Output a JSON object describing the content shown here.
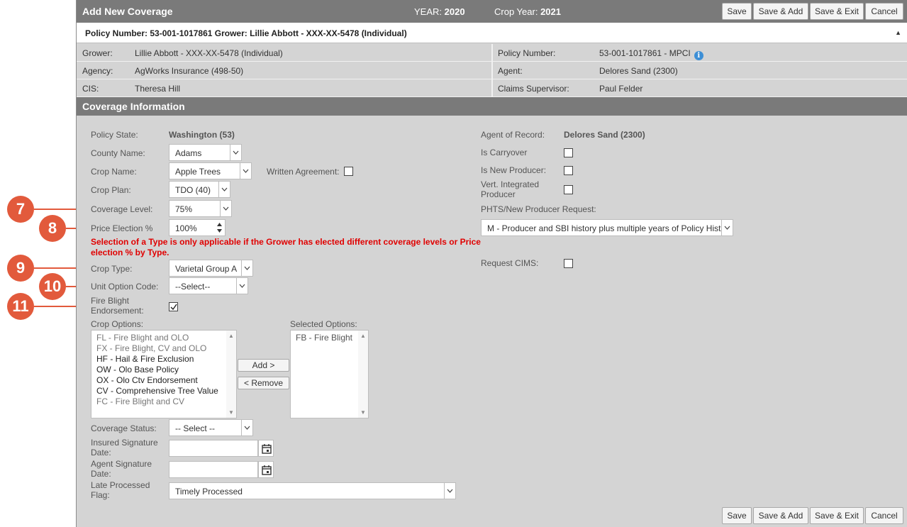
{
  "header": {
    "title": "Add New Coverage",
    "year_label": "YEAR:",
    "year_value": "2020",
    "crop_year_label": "Crop Year:",
    "crop_year_value": "2021",
    "buttons": {
      "save": "Save",
      "save_add": "Save & Add",
      "save_exit": "Save & Exit",
      "cancel": "Cancel"
    }
  },
  "policy_bar": {
    "text": "Policy Number: 53-001-1017861 Grower: Lillie Abbott - XXX-XX-5478 (Individual)",
    "collapse_glyph": "▲"
  },
  "info": {
    "grower_label": "Grower:",
    "grower_value": "Lillie Abbott - XXX-XX-5478 (Individual)",
    "policy_label": "Policy Number:",
    "policy_value": "53-001-1017861 - MPCI",
    "agency_label": "Agency:",
    "agency_value": "AgWorks Insurance (498-50)",
    "agent_label": "Agent:",
    "agent_value": "Delores Sand (2300)",
    "cis_label": "CIS:",
    "cis_value": "Theresa Hill",
    "claims_label": "Claims Supervisor:",
    "claims_value": "Paul Felder",
    "info_icon": "info-icon"
  },
  "section_title": "Coverage Information",
  "form": {
    "policy_state_label": "Policy State:",
    "policy_state_value": "Washington (53)",
    "county_label": "County Name:",
    "county_value": "Adams",
    "crop_name_label": "Crop Name:",
    "crop_name_value": "Apple Trees",
    "written_agreement_label": "Written Agreement:",
    "crop_plan_label": "Crop Plan:",
    "crop_plan_value": "TDO (40)",
    "coverage_level_label": "Coverage Level:",
    "coverage_level_value": "75%",
    "price_election_label": "Price Election %",
    "price_election_value": "100%",
    "warning": "Selection of a Type is only applicable if the Grower has elected different coverage levels or Price election % by Type.",
    "crop_type_label": "Crop Type:",
    "crop_type_value": "Varietal Group A",
    "unit_option_label": "Unit Option Code:",
    "unit_option_value": "--Select--",
    "fire_blight_label": "Fire Blight Endorsement:",
    "fire_blight_checked": true,
    "crop_options_label": "Crop Options:",
    "crop_options": [
      {
        "text": "FL - Fire Blight and OLO",
        "enabled": false
      },
      {
        "text": "FX - Fire Blight, CV and OLO",
        "enabled": false
      },
      {
        "text": "HF - Hail & Fire Exclusion",
        "enabled": true
      },
      {
        "text": "OW - Olo Base Policy",
        "enabled": true
      },
      {
        "text": "OX - Olo Ctv Endorsement",
        "enabled": true
      },
      {
        "text": "CV - Comprehensive Tree Value",
        "enabled": true
      },
      {
        "text": "FC - Fire Blight and CV",
        "enabled": false
      }
    ],
    "add_button": "Add >",
    "remove_button": "< Remove",
    "selected_options_label": "Selected Options:",
    "selected_options": [
      "FB - Fire Blight"
    ],
    "coverage_status_label": "Coverage Status:",
    "coverage_status_value": "-- Select --",
    "insured_sig_label": "Insured Signature Date:",
    "agent_sig_label": "Agent Signature Date:",
    "late_flag_label": "Late Processed Flag:",
    "late_flag_value": "Timely Processed",
    "agent_of_record_label": "Agent of Record:",
    "agent_of_record_value": "Delores Sand (2300)",
    "carryover_label": "Is Carryover",
    "new_producer_label": "Is New Producer:",
    "vert_integrated_label": "Vert. Integrated Producer",
    "phts_label": "PHTS/New Producer Request:",
    "phts_value": "M - Producer and SBI history plus multiple years of Policy History",
    "request_cims_label": "Request CIMS:"
  },
  "callouts": [
    "7",
    "8",
    "9",
    "10",
    "11"
  ],
  "colors": {
    "header_bg": "#7a7a7a",
    "panel_bg": "#d4d4d4",
    "callout": "#e25a3c",
    "warning": "#e00000"
  }
}
